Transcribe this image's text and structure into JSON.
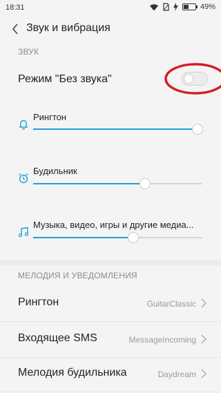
{
  "status": {
    "time": "18:31",
    "battery_percent": "49%",
    "battery_level": 0.49
  },
  "header": {
    "title": "Звук и вибрация"
  },
  "sound_section": {
    "label": "ЗВУК",
    "silent_mode": {
      "title": "Режим \"Без звука\"",
      "enabled": false
    }
  },
  "sliders": [
    {
      "label": "Рингтон",
      "icon": "bell-icon",
      "level": 0.97
    },
    {
      "label": "Будильник",
      "icon": "alarm-clock-icon",
      "level": 0.66
    },
    {
      "label": "Музыка, видео, игры и другие медиа...",
      "icon": "music-note-icon",
      "level": 0.59
    }
  ],
  "notifications_section": {
    "label": "МЕЛОДИЯ И УВЕДОМЛЕНИЯ",
    "items": [
      {
        "title": "Рингтон",
        "value": "GuitarClassic"
      },
      {
        "title": "Входящее SMS",
        "value": "MessageIncoming"
      },
      {
        "title": "Мелодия будильника",
        "value": "Daydream"
      }
    ]
  },
  "colors": {
    "accent": "#1f9ed9",
    "annotation": "#d0202a"
  }
}
